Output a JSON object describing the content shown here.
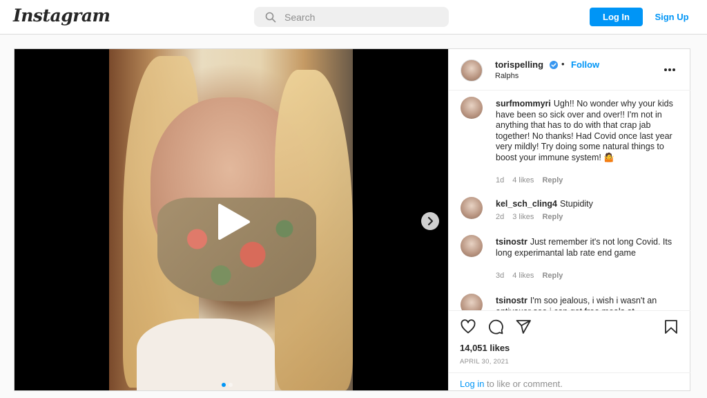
{
  "app": {
    "logo": "Instagram"
  },
  "search": {
    "placeholder": "Search"
  },
  "auth": {
    "login_label": "Log In",
    "signup_label": "Sign Up"
  },
  "colors": {
    "accent": "#0095f6",
    "border": "#dbdbdb",
    "muted": "#8e8e8e"
  },
  "post": {
    "username": "torispelling",
    "separator": "•",
    "follow_label": "Follow",
    "location": "Ralphs",
    "verified": true,
    "media_type": "video",
    "carousel_pages": 2,
    "likes": "14,051 likes",
    "date": "APRIL 30, 2021"
  },
  "comments": [
    {
      "username": "surfmommyri",
      "text": "Ugh!! No wonder why your kids have been so sick over and over!! I'm not in anything that has to do with that crap jab together! No thanks! Had Covid once last year very mildly! Try doing some natural things to boost your immune system! 🤷",
      "age": "1d",
      "likes": "4 likes",
      "reply_label": "Reply"
    },
    {
      "username": "kel_sch_cling4",
      "text": "Stupidity",
      "age": "2d",
      "likes": "3 likes",
      "reply_label": "Reply"
    },
    {
      "username": "tsinostr",
      "text": "Just remember it's not long Covid. Its long experimantal lab rate end game",
      "age": "3d",
      "likes": "4 likes",
      "reply_label": "Reply"
    },
    {
      "username": "tsinostr",
      "text": "I'm soo jealous, i wish i wasn't an antivaxer soo i can get free meals at",
      "age": "",
      "likes": "",
      "reply_label": ""
    }
  ],
  "footer": {
    "login_link": "Log in",
    "prompt_rest": " to like or comment."
  },
  "icons": [
    "search-icon",
    "verified-icon",
    "more-icon",
    "play-icon",
    "chevron-right-icon",
    "heart-icon",
    "comment-icon",
    "share-icon",
    "bookmark-icon"
  ]
}
